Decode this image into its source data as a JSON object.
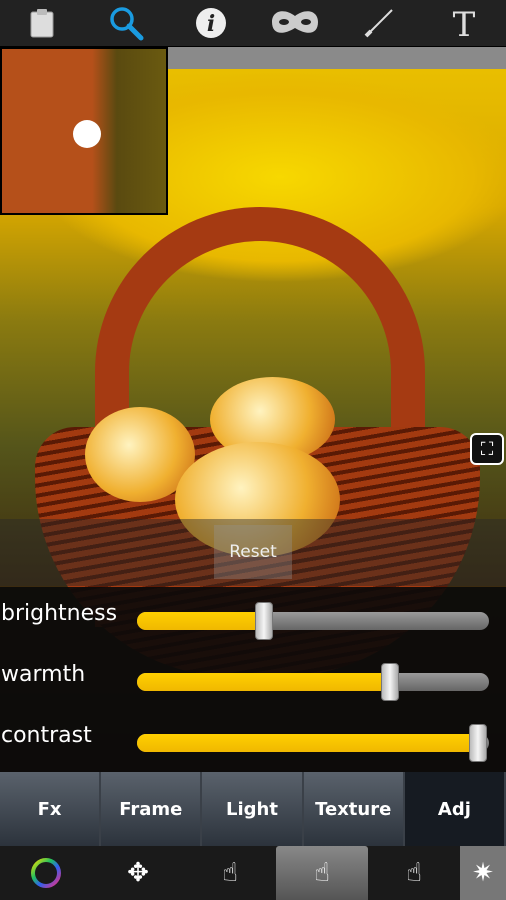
{
  "toolbar": {
    "icons": [
      "clipboard-icon",
      "search-icon",
      "info-icon",
      "mask-icon",
      "brush-icon",
      "text-icon"
    ],
    "active": "search-icon",
    "accent": "#1a9be0"
  },
  "reset_label": "Reset",
  "sliders": [
    {
      "label": "brightness",
      "value": 36
    },
    {
      "label": "warmth",
      "value": 72
    },
    {
      "label": "contrast",
      "value": 97
    }
  ],
  "tabs": [
    {
      "label": "Fx"
    },
    {
      "label": "Frame"
    },
    {
      "label": "Light"
    },
    {
      "label": "Texture"
    },
    {
      "label": "Adj",
      "active": true
    }
  ],
  "bottom_icons": [
    "color-ring-icon",
    "hand-move-icon",
    "hand-touch-icon",
    "hand-color-touch-icon",
    "hand-erase-icon",
    "magic-wand-icon"
  ],
  "slider_color": "#ffc800"
}
